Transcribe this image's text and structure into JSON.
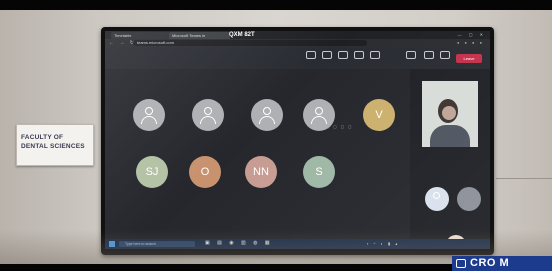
{
  "plaque": {
    "line1": "FACULTY OF",
    "line2": "DENTAL SCIENCES"
  },
  "browser": {
    "tabs": [
      "Timetable",
      "Microsoft Teams in"
    ],
    "meeting_code": "QXM 82T",
    "url": "teams.microsoft.com"
  },
  "meeting": {
    "leave_label": "Leave",
    "participants_row1": [
      {
        "type": "icon",
        "name": ""
      },
      {
        "type": "icon",
        "name": ""
      },
      {
        "type": "icon",
        "name": ""
      },
      {
        "type": "icon",
        "name": ""
      },
      {
        "type": "initials",
        "initials": "V",
        "color": "#cbb06d",
        "name": ""
      }
    ],
    "participants_row2": [
      {
        "initials": "SJ",
        "color": "#b3c1a4",
        "name": ""
      },
      {
        "initials": "O",
        "color": "#c9926f",
        "name": ""
      },
      {
        "initials": "NN",
        "color": "#c79c92",
        "name": ""
      },
      {
        "initials": "S",
        "color": "#9fb8a6",
        "name": ""
      }
    ]
  },
  "taskbar": {
    "search_placeholder": "Type here to search"
  },
  "watermark": {
    "text": "CRO M"
  }
}
